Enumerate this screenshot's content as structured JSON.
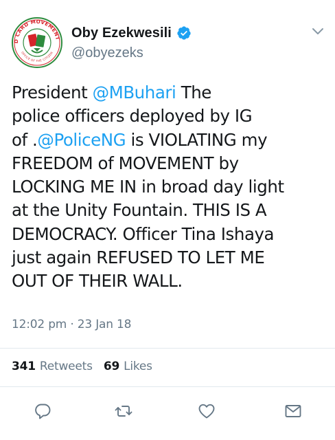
{
  "author": {
    "display_name": "Oby Ezekwesili",
    "handle": "@obyezeks",
    "verified": true,
    "avatar_logo_text": "RED CARD MOVEMENT NG",
    "avatar_icon": "red-card-movement-logo"
  },
  "tweet": {
    "lines": [
      [
        {
          "text": "President ",
          "type": "text"
        },
        {
          "text": "@MBuhari",
          "type": "mention"
        },
        {
          "text": " The",
          "type": "text"
        }
      ],
      [
        {
          "text": "police officers deployed by IG",
          "type": "text"
        }
      ],
      [
        {
          "text": "of .",
          "type": "text"
        },
        {
          "text": "@PoliceNG",
          "type": "mention"
        },
        {
          "text": " is VIOLATING my",
          "type": "text"
        }
      ],
      [
        {
          "text": "FREEDOM of MOVEMENT by",
          "type": "text"
        }
      ],
      [
        {
          "text": "LOCKING ME IN in broad day light",
          "type": "text"
        }
      ],
      [
        {
          "text": "at the Unity Fountain. THIS IS A",
          "type": "text"
        }
      ],
      [
        {
          "text": "DEMOCRACY. Officer Tina Ishaya",
          "type": "text"
        }
      ],
      [
        {
          "text": "just again REFUSED TO LET ME",
          "type": "text"
        }
      ],
      [
        {
          "text": "OUT OF THEIR WALL.",
          "type": "text"
        }
      ]
    ],
    "timestamp": "12:02 pm · 23 Jan 18"
  },
  "stats": {
    "retweets_count": "341",
    "retweets_label": "Retweets",
    "likes_count": "69",
    "likes_label": "Likes"
  },
  "actions": [
    {
      "name": "reply",
      "icon": "reply-icon"
    },
    {
      "name": "retweet",
      "icon": "retweet-icon"
    },
    {
      "name": "like",
      "icon": "heart-icon"
    },
    {
      "name": "direct-message",
      "icon": "envelope-icon"
    }
  ],
  "colors": {
    "text": "#14171a",
    "secondary": "#657786",
    "link": "#1da1f2",
    "verified": "#1da1f2",
    "divider": "#e1e8ed",
    "logo_red": "#d6242b",
    "logo_green": "#2e8b3e"
  }
}
